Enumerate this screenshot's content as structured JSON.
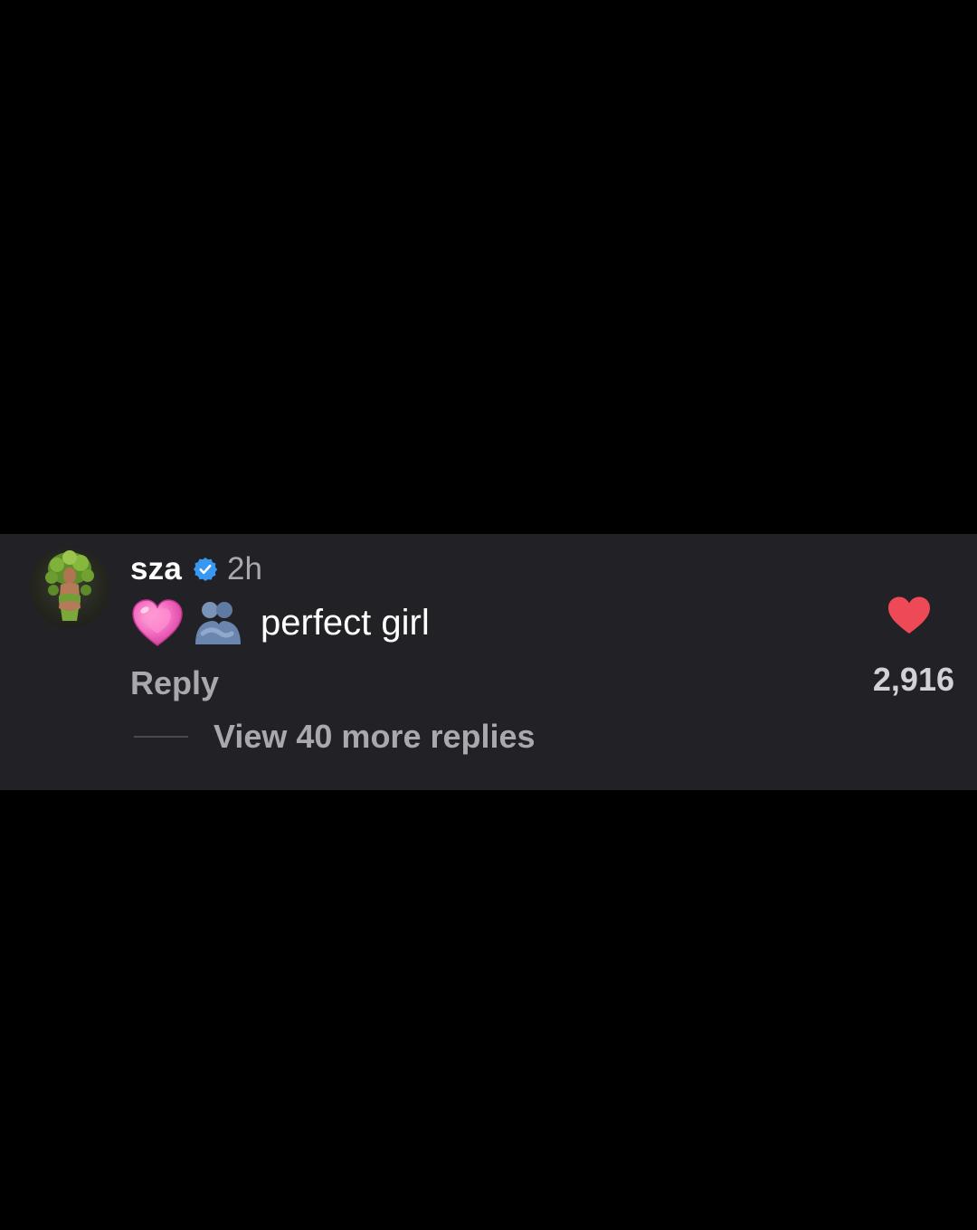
{
  "comment": {
    "username": "sza",
    "verified": true,
    "timestamp": "2h",
    "emojis": [
      "pink-heart-icon",
      "people-hugging-icon"
    ],
    "text": "perfect girl",
    "reply_label": "Reply",
    "like_count": "2,916",
    "view_replies_label": "View 40 more replies"
  },
  "colors": {
    "background": "#000000",
    "card": "#222226",
    "primary_text": "#ffffff",
    "secondary_text": "#a8a8ad",
    "verified_blue": "#3897f0",
    "like_red": "#ed4956"
  }
}
